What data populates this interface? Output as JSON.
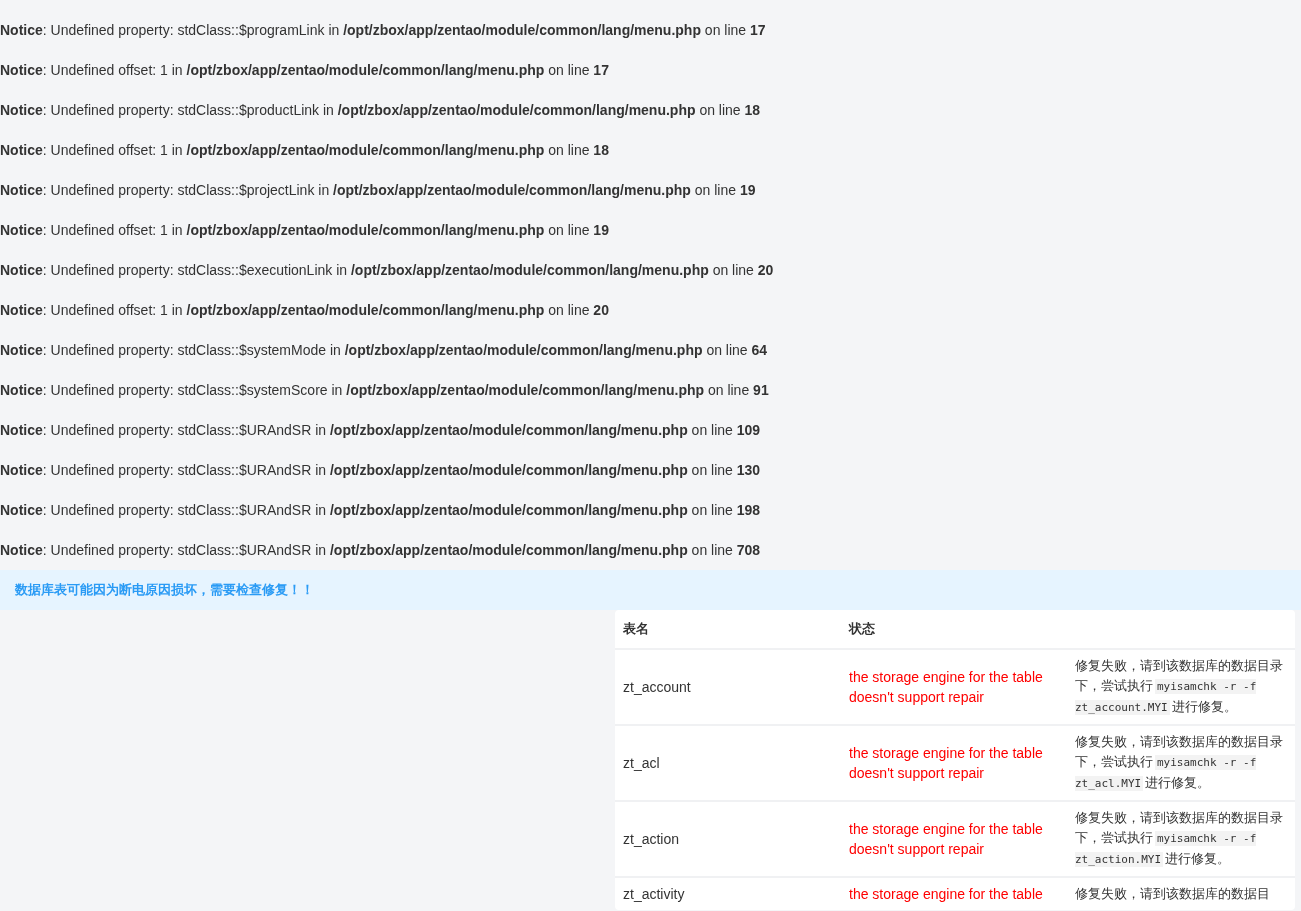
{
  "notices": [
    "**Notice**: Undefined property: stdClass::$programLink in **/opt/zbox/app/zentao/module/common/lang/menu.php** on line **17**",
    "**Notice**: Undefined offset: 1 in **/opt/zbox/app/zentao/module/common/lang/menu.php** on line **17**",
    "**Notice**: Undefined property: stdClass::$productLink in **/opt/zbox/app/zentao/module/common/lang/menu.php** on line **18**",
    "**Notice**: Undefined offset: 1 in **/opt/zbox/app/zentao/module/common/lang/menu.php** on line **18**",
    "**Notice**: Undefined property: stdClass::$projectLink in **/opt/zbox/app/zentao/module/common/lang/menu.php** on line **19**",
    "**Notice**: Undefined offset: 1 in **/opt/zbox/app/zentao/module/common/lang/menu.php** on line **19**",
    "**Notice**: Undefined property: stdClass::$executionLink in **/opt/zbox/app/zentao/module/common/lang/menu.php** on line **20**",
    "**Notice**: Undefined offset: 1 in **/opt/zbox/app/zentao/module/common/lang/menu.php** on line **20**",
    "**Notice**: Undefined property: stdClass::$systemMode in **/opt/zbox/app/zentao/module/common/lang/menu.php** on line **64**",
    "**Notice**: Undefined property: stdClass::$systemScore in **/opt/zbox/app/zentao/module/common/lang/menu.php** on line **91**",
    "**Notice**: Undefined property: stdClass::$URAndSR in **/opt/zbox/app/zentao/module/common/lang/menu.php** on line **109**",
    "**Notice**: Undefined property: stdClass::$URAndSR in **/opt/zbox/app/zentao/module/common/lang/menu.php** on line **130**",
    "**Notice**: Undefined property: stdClass::$URAndSR in **/opt/zbox/app/zentao/module/common/lang/menu.php** on line **198**",
    "**Notice**: Undefined property: stdClass::$URAndSR in **/opt/zbox/app/zentao/module/common/lang/menu.php** on line **708**"
  ],
  "alert": {
    "text": "数据库表可能因为断电原因损坏，需要检查修复！！"
  },
  "table": {
    "columns": [
      "表名",
      "状态"
    ],
    "rows": [
      {
        "name": "zt_account",
        "status": "the storage engine for the table doesn't support repair",
        "repair": [
          {
            "kind": "text",
            "text": "修复失败，请到该数据库的数据目录下，尝试执行"
          },
          {
            "kind": "code",
            "text": "myisamchk -r -f zt_account.MYI"
          },
          {
            "kind": "text",
            "text": "进行修复。"
          }
        ]
      },
      {
        "name": "zt_acl",
        "status": "the storage engine for the table doesn't support repair",
        "repair": [
          {
            "kind": "text",
            "text": "修复失败，请到该数据库的数据目录下，尝试执行"
          },
          {
            "kind": "code",
            "text": "myisamchk -r -f zt_acl.MYI"
          },
          {
            "kind": "text",
            "text": "进行修复。"
          }
        ]
      },
      {
        "name": "zt_action",
        "status": "the storage engine for the table doesn't support repair",
        "repair": [
          {
            "kind": "text",
            "text": "修复失败，请到该数据库的数据目录下，尝试执行"
          },
          {
            "kind": "code",
            "text": "myisamchk -r -f zt_action.MYI"
          },
          {
            "kind": "text",
            "text": "进行修复。"
          }
        ]
      },
      {
        "name": "zt_activity",
        "status": "the storage engine for the table",
        "repair": [
          {
            "kind": "text",
            "text": "修复失败，请到该数据库的数据目"
          }
        ]
      }
    ]
  }
}
